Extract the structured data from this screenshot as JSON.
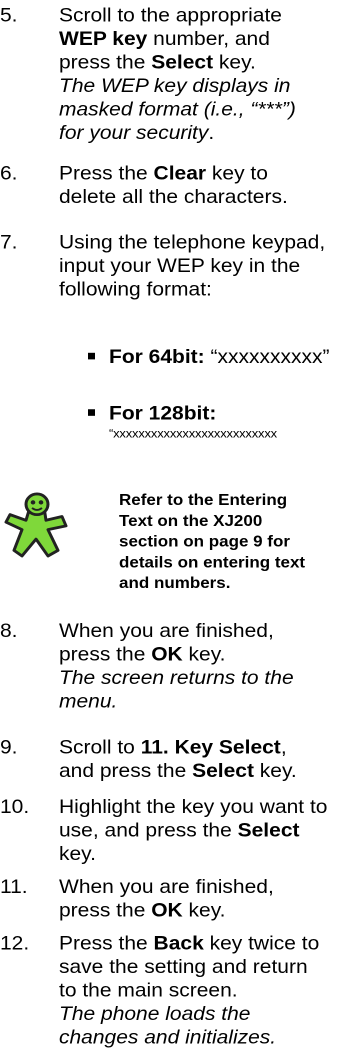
{
  "steps": [
    {
      "number": "5.",
      "lines": [
        {
          "a": "Scroll to the appropriate"
        },
        {
          "b": "WEP key",
          "a": " number, and"
        },
        {
          "a": "press the ",
          "b": "Select",
          "c": " key."
        },
        {
          "i": "The WEP key displays in"
        },
        {
          "i": "masked format (i.e., “***”)"
        },
        {
          "i": "for your security",
          "a": "."
        }
      ]
    },
    {
      "number": "6.",
      "lines": [
        {
          "a": "Press the ",
          "b": "Clear",
          "c": " key to"
        },
        {
          "a": "delete all the characters."
        }
      ]
    },
    {
      "number": "7.",
      "lines": [
        {
          "a": "Using the telephone keypad,"
        },
        {
          "a": "input your WEP key in the"
        },
        {
          "a": "following format:"
        }
      ]
    },
    {
      "number": "8.",
      "lines": [
        {
          "a": "When you are finished,"
        },
        {
          "a": "press the ",
          "b": "OK",
          "c": " key."
        },
        {
          "i": "The screen returns to the"
        },
        {
          "i": "menu."
        }
      ]
    },
    {
      "number": "9.",
      "lines": [
        {
          "a": "Scroll to ",
          "b": "11. Key Select",
          "c": ","
        },
        {
          "a": "and press the ",
          "b": "Select",
          "c": " key."
        }
      ]
    },
    {
      "number": "10.",
      "lines": [
        {
          "a": "Highlight the key you want to"
        },
        {
          "a": "use, and press the ",
          "b": "Select"
        },
        {
          "a": "key."
        }
      ]
    },
    {
      "number": "11.",
      "lines": [
        {
          "a": "When you are finished,"
        },
        {
          "a": "press the ",
          "b": "OK",
          "c": " key."
        }
      ]
    },
    {
      "number": "12.",
      "lines": [
        {
          "a": "Press the ",
          "b": "Back",
          "c": " key twice to"
        },
        {
          "a": "save the setting and return"
        },
        {
          "a": "to the main screen."
        },
        {
          "i": "The phone loads the"
        },
        {
          "i": "changes and initializes."
        }
      ]
    }
  ],
  "bullets": [
    {
      "label": "For 64bit:",
      "value": " “xxxxxxxxxx”"
    },
    {
      "label": "For 128bit:",
      "value": "“xxxxxxxxxxxxxxxxxxxxxxxxxx"
    }
  ],
  "tip": {
    "lines": [
      "Refer to the Entering",
      "Text on the XJ200",
      "section on page 9 for",
      "details on entering text",
      "and numbers."
    ],
    "icon": "mascot-icon",
    "icon_color": "#7fd83a"
  }
}
